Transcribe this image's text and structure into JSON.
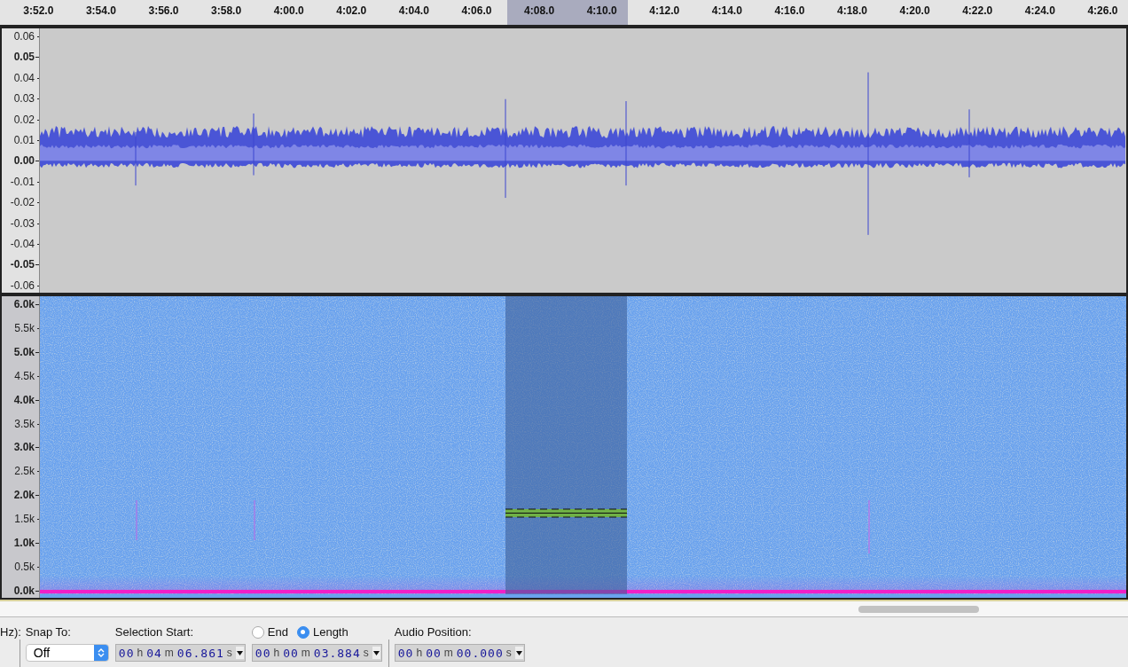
{
  "ruler": {
    "ticks": [
      "3:52.0",
      "3:54.0",
      "3:56.0",
      "3:58.0",
      "4:00.0",
      "4:02.0",
      "4:04.0",
      "4:06.0",
      "4:08.0",
      "4:10.0",
      "4:12.0",
      "4:14.0",
      "4:16.0",
      "4:18.0",
      "4:20.0",
      "4:22.0",
      "4:24.0",
      "4:26.0"
    ]
  },
  "waveform_track": {
    "axis": [
      {
        "label": "0.06",
        "major": false
      },
      {
        "label": "0.05",
        "major": true
      },
      {
        "label": "0.04",
        "major": false
      },
      {
        "label": "0.03",
        "major": false
      },
      {
        "label": "0.02",
        "major": false
      },
      {
        "label": "0.01",
        "major": false
      },
      {
        "label": "0.00",
        "major": true
      },
      {
        "label": "-0.01",
        "major": false
      },
      {
        "label": "-0.02",
        "major": false
      },
      {
        "label": "-0.03",
        "major": false
      },
      {
        "label": "-0.04",
        "major": false
      },
      {
        "label": "-0.05",
        "major": true
      },
      {
        "label": "-0.06",
        "major": false
      }
    ]
  },
  "spectrogram_track": {
    "axis": [
      {
        "label": "6.0k",
        "major": true
      },
      {
        "label": "5.5k",
        "major": false
      },
      {
        "label": "5.0k",
        "major": true
      },
      {
        "label": "4.5k",
        "major": false
      },
      {
        "label": "4.0k",
        "major": true
      },
      {
        "label": "3.5k",
        "major": false
      },
      {
        "label": "3.0k",
        "major": true
      },
      {
        "label": "2.5k",
        "major": false
      },
      {
        "label": "2.0k",
        "major": true
      },
      {
        "label": "1.5k",
        "major": false
      },
      {
        "label": "1.0k",
        "major": true
      },
      {
        "label": "0.5k",
        "major": false
      },
      {
        "label": "0.0k",
        "major": true
      }
    ]
  },
  "toolbar": {
    "cut_label": "Hz):",
    "snap_label": "Snap To:",
    "snap_value": "Off",
    "selection_label": "Selection Start:",
    "selection_start": [
      {
        "value": "00",
        "unit": "h"
      },
      {
        "value": "04",
        "unit": "m"
      },
      {
        "value": "06.861",
        "unit": "s"
      }
    ],
    "modes": [
      {
        "label": "End",
        "selected": false
      },
      {
        "label": "Length",
        "selected": true
      }
    ],
    "selection_length": [
      {
        "value": "00",
        "unit": "h"
      },
      {
        "value": "00",
        "unit": "m"
      },
      {
        "value": "03.884",
        "unit": "s"
      }
    ],
    "audio_position_label": "Audio Position:",
    "audio_position": [
      {
        "value": "00",
        "unit": "h"
      },
      {
        "value": "00",
        "unit": "m"
      },
      {
        "value": "00.000",
        "unit": "s"
      }
    ]
  }
}
